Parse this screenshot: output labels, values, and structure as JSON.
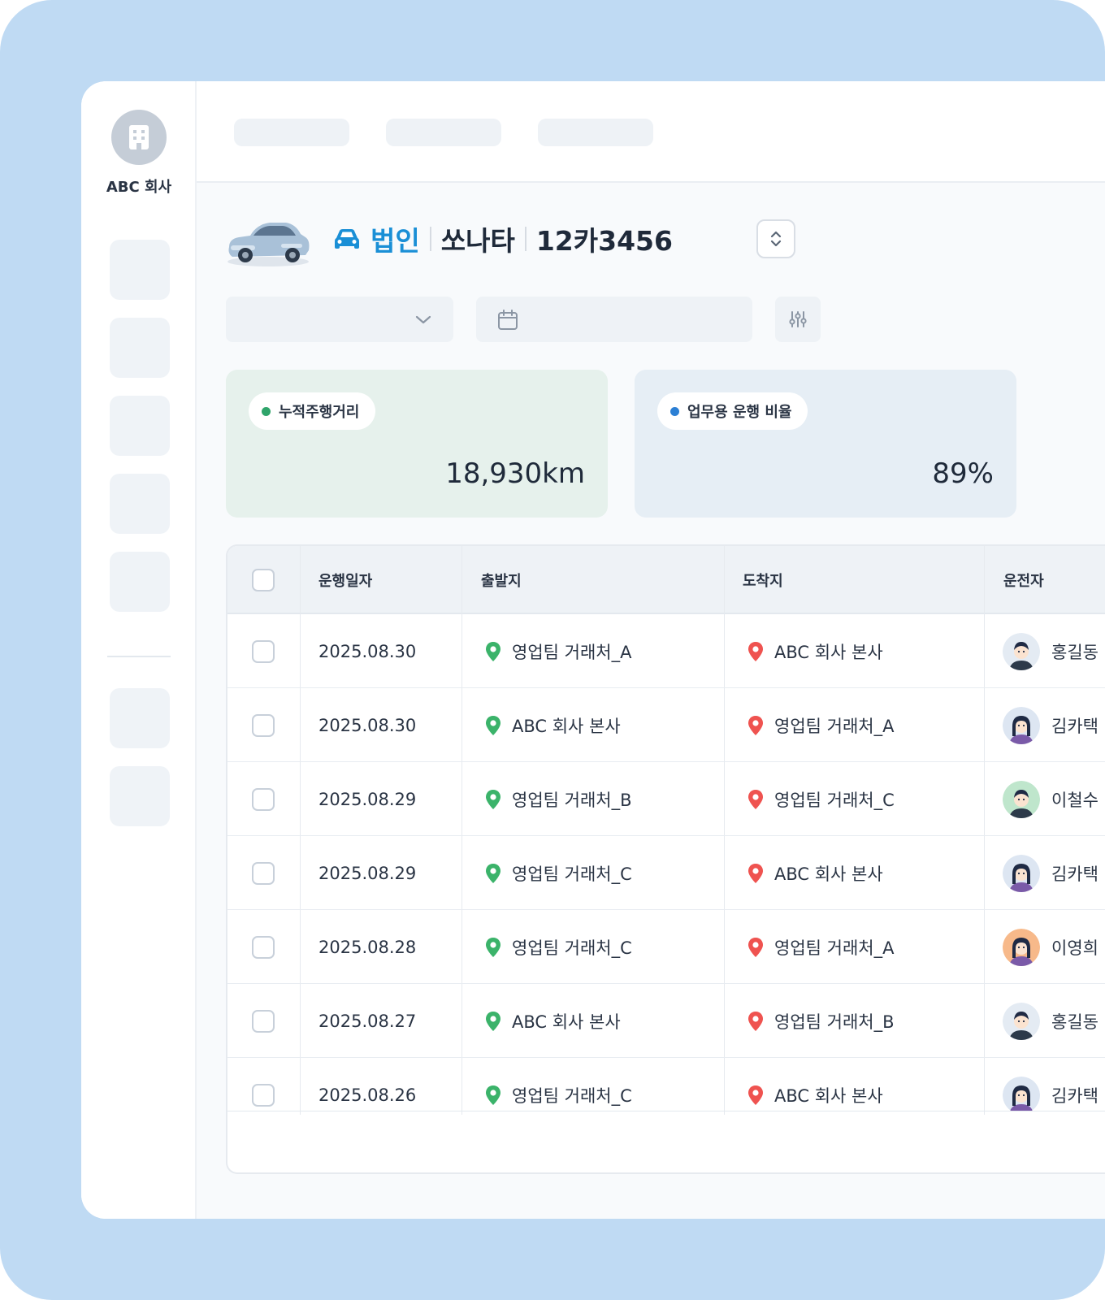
{
  "company": {
    "name": "ABC 회사",
    "logo_icon": "building-icon"
  },
  "vehicle": {
    "type_label": "법인",
    "model": "쏘나타",
    "plate": "12카3456",
    "image": "car-image",
    "type_icon": "car-icon",
    "accent_color": "#1a8fd6"
  },
  "stats": [
    {
      "label": "누적주행거리",
      "value": "18,930km",
      "dot_color": "#2fa46a"
    },
    {
      "label": "업무용 운행 비율",
      "value": "89%",
      "dot_color": "#2b7fd4"
    }
  ],
  "table": {
    "headers": {
      "date": "운행일자",
      "origin": "출발지",
      "destination": "도착지",
      "driver": "운전자"
    },
    "rows": [
      {
        "date": "2025.08.30",
        "origin": "영업팀 거래처_A",
        "destination": "ABC 회사 본사",
        "driver": "홍길동",
        "avatar": "male-1"
      },
      {
        "date": "2025.08.30",
        "origin": "ABC 회사 본사",
        "destination": "영업팀 거래처_A",
        "driver": "김카택",
        "avatar": "female-1"
      },
      {
        "date": "2025.08.29",
        "origin": "영업팀 거래처_B",
        "destination": "영업팀 거래처_C",
        "driver": "이철수",
        "avatar": "male-2"
      },
      {
        "date": "2025.08.29",
        "origin": "영업팀 거래처_C",
        "destination": "ABC 회사 본사",
        "driver": "김카택",
        "avatar": "female-1"
      },
      {
        "date": "2025.08.28",
        "origin": "영업팀 거래처_C",
        "destination": "영업팀 거래처_A",
        "driver": "이영희",
        "avatar": "female-2"
      },
      {
        "date": "2025.08.27",
        "origin": "ABC 회사 본사",
        "destination": "영업팀 거래처_B",
        "driver": "홍길동",
        "avatar": "male-1"
      },
      {
        "date": "2025.08.26",
        "origin": "영업팀 거래처_C",
        "destination": "ABC 회사 본사",
        "driver": "김카택",
        "avatar": "female-1"
      }
    ]
  },
  "colors": {
    "origin_pin": "#3bb36a",
    "destination_pin": "#ef5350"
  }
}
